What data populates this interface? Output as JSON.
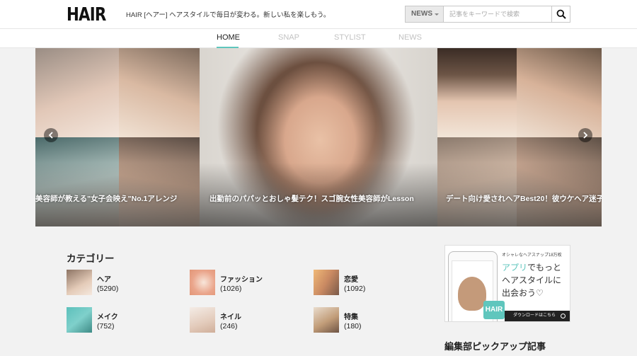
{
  "header": {
    "logo": "HAIR",
    "tagline": "HAIR [ヘアー] ヘアスタイルで毎日が変わる。新しい私を楽しもう。",
    "search": {
      "category": "NEWS",
      "placeholder": "記事をキーワードで検索"
    }
  },
  "nav": {
    "items": [
      {
        "label": "HOME",
        "active": true
      },
      {
        "label": "SNAP",
        "active": false
      },
      {
        "label": "STYLIST",
        "active": false
      },
      {
        "label": "NEWS",
        "active": false
      }
    ]
  },
  "slider": {
    "slides": [
      {
        "caption": "美容師が教える\"女子会映え\"No.1アレンジ"
      },
      {
        "caption": "出勤前のパパッとおしゃ髪テク！スゴ腕女性美容師がLesson"
      },
      {
        "caption": "デート向け愛されヘアBest20！彼ウケヘア迷子"
      }
    ]
  },
  "categories": {
    "title": "カテゴリー",
    "items": [
      {
        "name": "ヘア",
        "count": "(5290)",
        "color": "#c9a48a"
      },
      {
        "name": "ファッション",
        "count": "(1026)",
        "color": "#e8a48c"
      },
      {
        "name": "恋愛",
        "count": "(1092)",
        "color": "#d89a6c"
      },
      {
        "name": "メイク",
        "count": "(752)",
        "color": "#6cc4bf"
      },
      {
        "name": "ネイル",
        "count": "(246)",
        "color": "#e9d6c8"
      },
      {
        "name": "特集",
        "count": "(180)",
        "color": "#c4a27e"
      }
    ]
  },
  "app_banner": {
    "small_text": "オシャレなヘアスナップ18万枚",
    "line1_highlight": "アプリ",
    "line1_rest": "でもっと",
    "line2": "ヘアスタイルに",
    "line3": "出会おう♡",
    "badge": "HAIR",
    "download": "ダウンロードはこちら"
  },
  "pickup": {
    "title": "編集部ピックアップ記事"
  },
  "colors": {
    "accent": "#5fc6bd"
  }
}
